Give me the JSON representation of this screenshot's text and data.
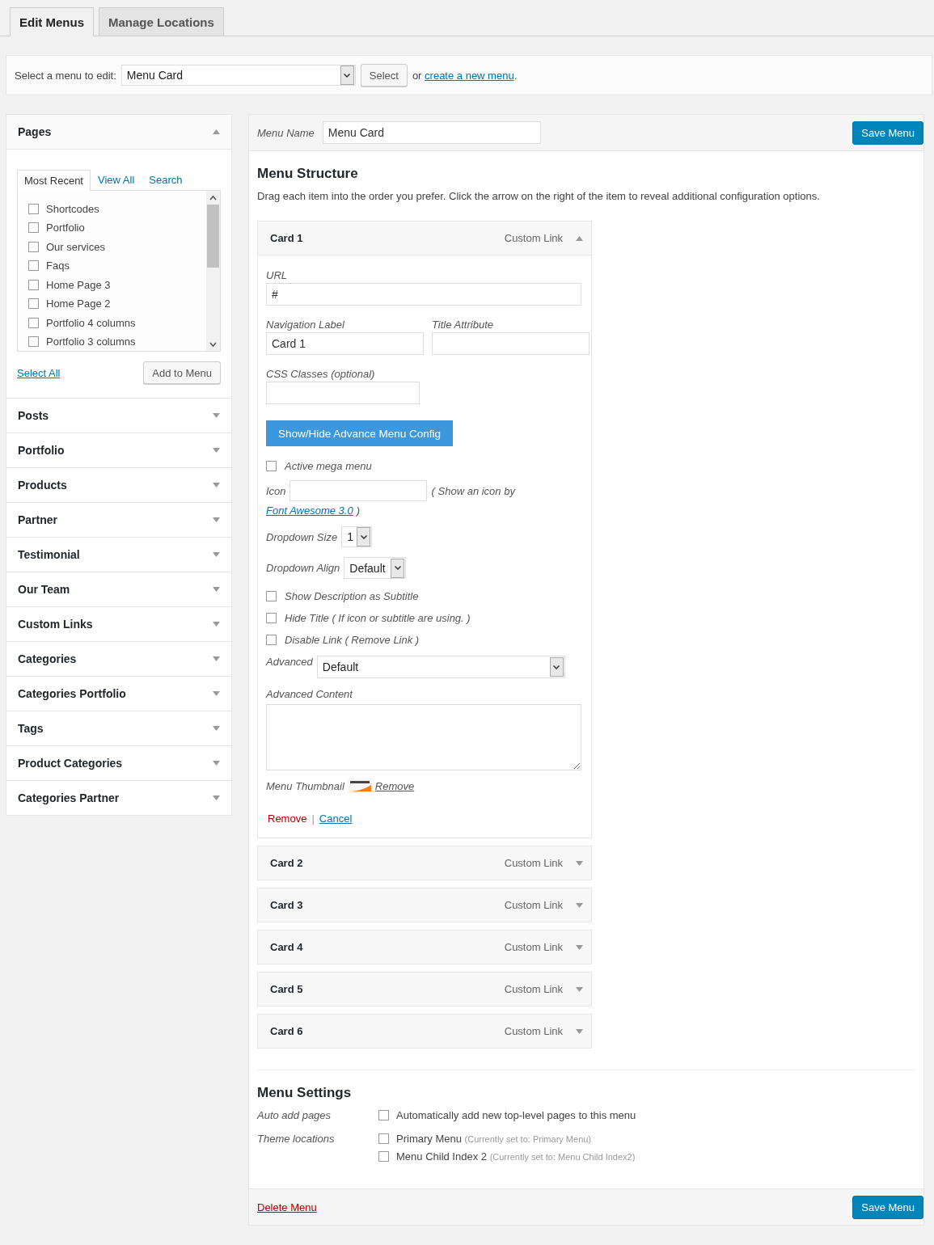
{
  "tabs": [
    {
      "label": "Edit Menus",
      "selected": true
    },
    {
      "label": "Manage Locations",
      "selected": false
    }
  ],
  "menu_select": {
    "label": "Select a menu to edit:",
    "value": "Menu Card",
    "button": "Select",
    "or_text": "or",
    "link": "create a new menu",
    "period": "."
  },
  "sidebar": {
    "sections": [
      {
        "title": "Pages",
        "expanded": true,
        "tabs": [
          {
            "label": "Most Recent",
            "selected": true
          },
          {
            "label": "View All",
            "selected": false
          },
          {
            "label": "Search",
            "selected": false
          }
        ],
        "items": [
          {
            "label": "Shortcodes",
            "checked": false
          },
          {
            "label": "Portfolio",
            "checked": false
          },
          {
            "label": "Our services",
            "checked": false
          },
          {
            "label": "Faqs",
            "checked": false
          },
          {
            "label": "Home Page 3",
            "checked": false
          },
          {
            "label": "Home Page 2",
            "checked": false
          },
          {
            "label": "Portfolio 4 columns",
            "checked": false
          },
          {
            "label": "Portfolio 3 columns",
            "checked": false
          }
        ],
        "select_all": "Select All",
        "add_button": "Add to Menu"
      },
      {
        "title": "Posts",
        "expanded": false
      },
      {
        "title": "Portfolio",
        "expanded": false
      },
      {
        "title": "Products",
        "expanded": false
      },
      {
        "title": "Partner",
        "expanded": false
      },
      {
        "title": "Testimonial",
        "expanded": false
      },
      {
        "title": "Our Team",
        "expanded": false
      },
      {
        "title": "Custom Links",
        "expanded": false
      },
      {
        "title": "Categories",
        "expanded": false
      },
      {
        "title": "Categories Portfolio",
        "expanded": false
      },
      {
        "title": "Tags",
        "expanded": false
      },
      {
        "title": "Product Categories",
        "expanded": false
      },
      {
        "title": "Categories Partner",
        "expanded": false
      }
    ]
  },
  "editor": {
    "menu_name_label": "Menu Name",
    "menu_name": "Menu Card",
    "save_button": "Save Menu",
    "structure_title": "Menu Structure",
    "structure_hint": "Drag each item into the order you prefer. Click the arrow on the right of the item to reveal additional configuration options.",
    "items": [
      {
        "title": "Card 1",
        "type": "Custom Link",
        "expanded": true,
        "settings": {
          "url_label": "URL",
          "url": "#",
          "nav_label_label": "Navigation Label",
          "nav_label": "Card 1",
          "title_attr_label": "Title Attribute",
          "css_label": "CSS Classes (optional)",
          "config_button": "Show/Hide Advance Menu Config",
          "mega_menu": {
            "label": "Active mega menu",
            "checked": false
          },
          "icon_label": "Icon",
          "icon_hint_prefix": "( Show an icon by",
          "icon_link": "Font Awesome 3.0",
          "icon_hint_suffix": ")",
          "dropdown_size": {
            "label": "Dropdown Size",
            "value": "1"
          },
          "dropdown_align": {
            "label": "Dropdown Align",
            "value": "Default"
          },
          "checks": [
            {
              "label": "Show Description as Subtitle",
              "checked": false
            },
            {
              "label": "Hide Title ( If icon or subtitle are using. )",
              "checked": false
            },
            {
              "label": "Disable Link ( Remove Link )",
              "checked": false
            }
          ],
          "advanced": {
            "label": "Advanced",
            "value": "Default"
          },
          "advanced_content_label": "Advanced Content",
          "thumbnail_label": "Menu Thumbnail",
          "thumbnail_remove": "Remove",
          "remove": "Remove",
          "separator": "|",
          "cancel": "Cancel"
        }
      },
      {
        "title": "Card 2",
        "type": "Custom Link",
        "expanded": false
      },
      {
        "title": "Card 3",
        "type": "Custom Link",
        "expanded": false
      },
      {
        "title": "Card 4",
        "type": "Custom Link",
        "expanded": false
      },
      {
        "title": "Card 5",
        "type": "Custom Link",
        "expanded": false
      },
      {
        "title": "Card 6",
        "type": "Custom Link",
        "expanded": false
      }
    ],
    "menu_settings": {
      "title": "Menu Settings",
      "rows": [
        {
          "label": "Auto add pages",
          "options": [
            {
              "label": "Automatically add new top-level pages to this menu",
              "checked": false
            }
          ]
        },
        {
          "label": "Theme locations",
          "options": [
            {
              "label": "Primary Menu",
              "note": "(Currently set to: Primary Menu)",
              "checked": false
            },
            {
              "label": "Menu Child Index 2",
              "note": "(Currently set to: Menu Child Index2)",
              "checked": false
            }
          ]
        }
      ]
    },
    "footer": {
      "delete_link": "Delete Menu",
      "save_button": "Save Menu"
    }
  }
}
